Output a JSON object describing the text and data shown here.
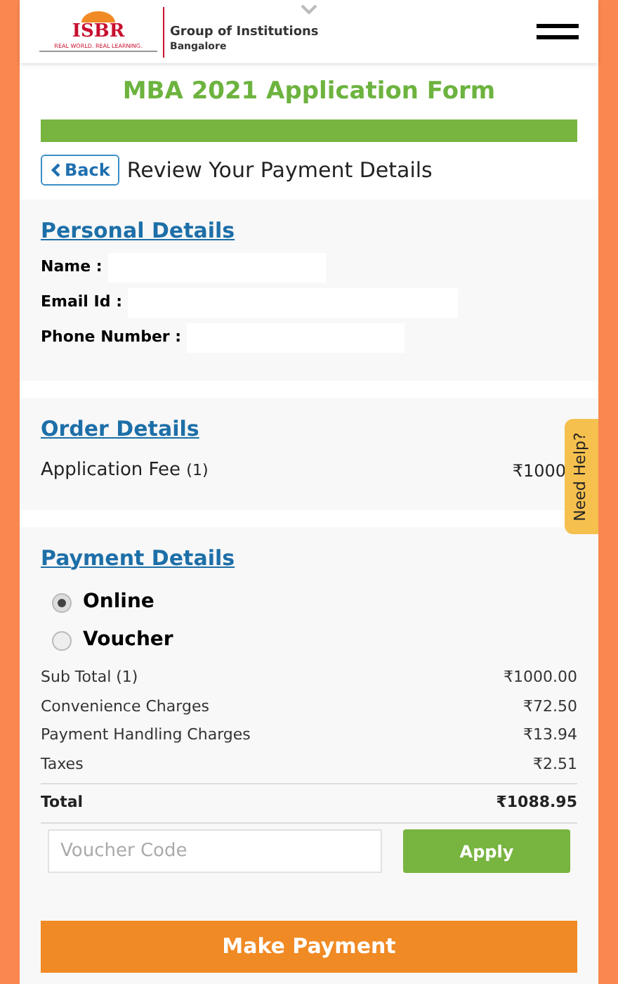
{
  "header": {
    "logo_text": "ISBR",
    "logo_tagline": "REAL WORLD. REAL LEARNING.",
    "org_name": "Group of Institutions",
    "org_city": "Bangalore"
  },
  "title": "MBA 2021 Application Form",
  "progress": {
    "level": 1
  },
  "back_button": "Back",
  "page_heading": "Review Your Payment Details",
  "personal": {
    "heading": "Personal Details",
    "fields": [
      {
        "label": "Name :"
      },
      {
        "label": "Email Id :"
      },
      {
        "label": "Phone Number :"
      }
    ]
  },
  "order": {
    "heading": "Order Details",
    "item": "Application Fee",
    "count": "(1)",
    "amount": "₹1000"
  },
  "payment": {
    "heading": "Payment Details",
    "methods": [
      {
        "label": "Online",
        "selected": true
      },
      {
        "label": "Voucher",
        "selected": false
      }
    ],
    "lines": [
      {
        "label": "Sub Total (1)",
        "amount": "₹1000.00"
      },
      {
        "label": "Convenience Charges",
        "amount": "₹72.50"
      },
      {
        "label": "Payment Handling Charges",
        "amount": "₹13.94"
      },
      {
        "label": "Taxes",
        "amount": "₹2.51"
      }
    ],
    "total": {
      "label": "Total",
      "amount": "₹1088.95"
    },
    "voucher": {
      "placeholder": "Voucher Code",
      "button": "Apply"
    },
    "submit": "Make Payment"
  },
  "help_tab": "Need Help?"
}
